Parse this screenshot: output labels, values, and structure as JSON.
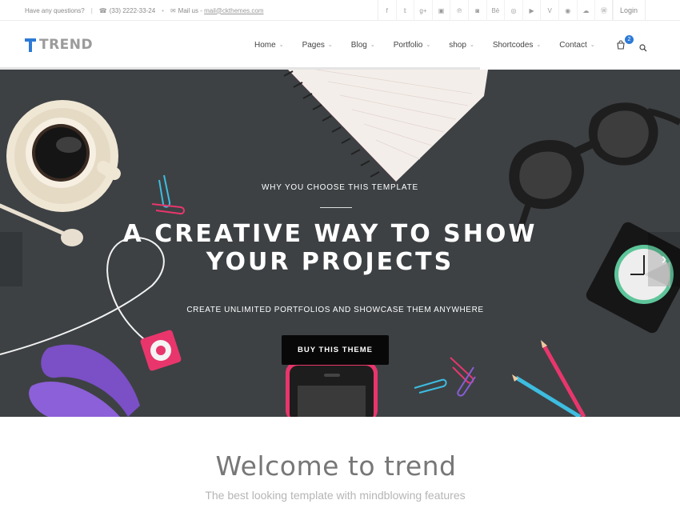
{
  "topbar": {
    "question": "Have any questions?",
    "phone": "(33) 2222-33-24",
    "mail_label": "Mail us -",
    "mail": "mail@ckthemes.com",
    "socials": [
      "facebook-icon",
      "twitter-icon",
      "google-plus-icon",
      "dribbble-icon",
      "pinterest-icon",
      "instagram-icon",
      "behance-icon",
      "flickr-icon",
      "youtube-icon",
      "vimeo-icon",
      "github-icon",
      "soundcloud-icon",
      "wordpress-icon"
    ],
    "social_glyphs": [
      "f",
      "𝕥",
      "g+",
      "▣",
      "℗",
      "◙",
      "Bē",
      "◎",
      "▶",
      "V",
      "◉",
      "☁",
      "Ⓦ"
    ],
    "login": "Login"
  },
  "header": {
    "logo": "TREND",
    "nav": [
      "Home",
      "Pages",
      "Blog",
      "Portfolio",
      "shop",
      "Shortcodes",
      "Contact"
    ],
    "cart_count": "2"
  },
  "hero": {
    "eyebrow": "WHY YOU CHOOSE THIS TEMPLATE",
    "headline_line1": "A CREATIVE WAY TO SHOW",
    "headline_line2": "YOUR PROJECTS",
    "subtitle": "CREATE UNLIMITED PORTFOLIOS AND SHOWCASE THEM ANYWHERE",
    "cta": "BUY THIS THEME",
    "next_arrow": "›"
  },
  "welcome": {
    "title": "Welcome to trend",
    "subtitle": "The best looking template with mindblowing features"
  },
  "colors": {
    "accent": "#2d7ad6",
    "hero_bg": "#3d4144",
    "button": "#080808"
  }
}
